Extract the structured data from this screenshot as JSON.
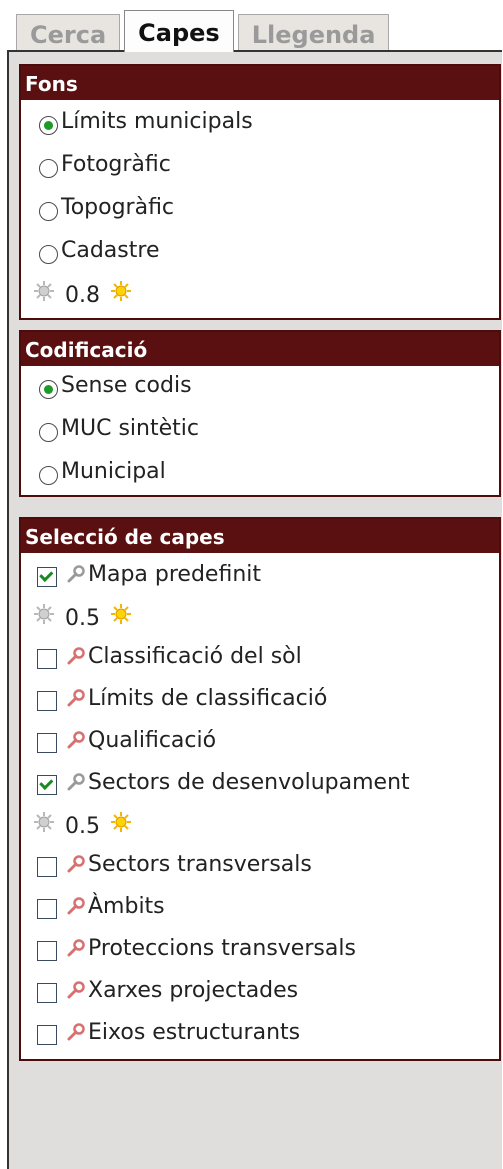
{
  "tabs": [
    "Cerca",
    "Capes",
    "Llegenda"
  ],
  "fons": {
    "title": "Fons",
    "options": [
      "Límits municipals",
      "Fotogràfic",
      "Topogràfic",
      "Cadastre"
    ],
    "selected": "Límits municipals",
    "opacity": "0.8"
  },
  "codificacio": {
    "title": "Codificació",
    "options": [
      "Sense codis",
      "MUC sintètic",
      "Municipal"
    ],
    "selected": "Sense codis"
  },
  "seleccio": {
    "title": "Selecció de capes",
    "layers": [
      {
        "label": "Mapa predefinit",
        "checked": true,
        "opacity": "0.5"
      },
      {
        "label": "Classificació del sòl",
        "checked": false
      },
      {
        "label": "Límits de classificació",
        "checked": false
      },
      {
        "label": "Qualificació",
        "checked": false
      },
      {
        "label": "Sectors de desenvolupament",
        "checked": true,
        "opacity": "0.5"
      },
      {
        "label": "Sectors transversals",
        "checked": false
      },
      {
        "label": "Àmbits",
        "checked": false
      },
      {
        "label": "Proteccions transversals",
        "checked": false
      },
      {
        "label": "Xarxes projectades",
        "checked": false
      },
      {
        "label": "Eixos estructurants",
        "checked": false
      }
    ]
  },
  "colors": {
    "header": "#5a1010",
    "radio_on": "#1e9a28",
    "panel_bg": "#e0dddd"
  }
}
